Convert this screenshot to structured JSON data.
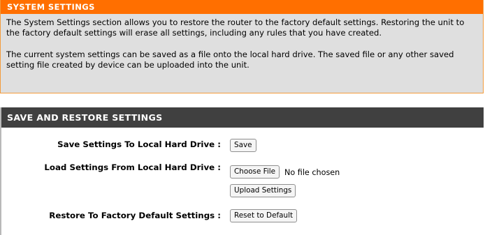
{
  "system_settings": {
    "header": "SYSTEM SETTINGS",
    "description_1": "The System Settings section allows you to restore the router to the factory default settings. Restoring the unit to the factory default settings will erase all settings, including any rules that you have created.",
    "description_2": "The current system settings can be saved as a file onto the local hard drive. The saved file or any other saved setting file created by device can be uploaded into the unit."
  },
  "save_restore": {
    "header": "SAVE AND RESTORE SETTINGS",
    "save_label": "Save Settings To Local Hard Drive :",
    "save_button": "Save",
    "load_label": "Load Settings From Local Hard Drive :",
    "choose_file_button": "Choose File",
    "file_status": "No file chosen",
    "upload_button": "Upload Settings",
    "restore_label": "Restore To Factory Default Settings :",
    "reset_button": "Reset to Default"
  },
  "colors": {
    "orange_header": "#ff6f00",
    "dark_header": "#404040",
    "panel_background": "#dfdfdf"
  }
}
